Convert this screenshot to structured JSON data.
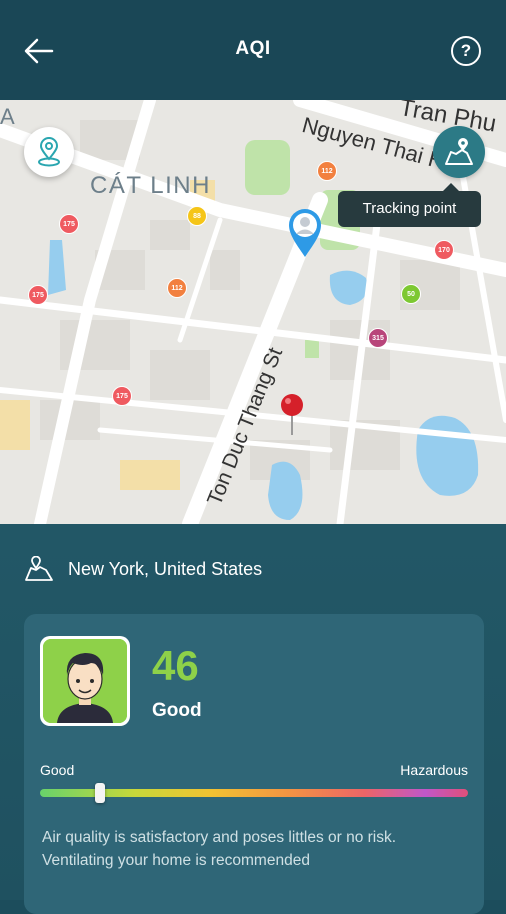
{
  "header": {
    "title": "AQI",
    "back_icon": "arrow-left-icon",
    "help_label": "?"
  },
  "map": {
    "labels": {
      "district": "CÁT LINH",
      "street_main": "Ton Duc Thang St",
      "street_top": "Nguyen Thai Hoc",
      "street_top2": "Tran Phu",
      "edge_letter": "A"
    },
    "tooltip": "Tracking point",
    "aqi_markers": [
      {
        "value": "175",
        "color": "#ef5a60"
      },
      {
        "value": "175",
        "color": "#ef5a60"
      },
      {
        "value": "175",
        "color": "#ef5a60"
      },
      {
        "value": "88",
        "color": "#f5c518"
      },
      {
        "value": "112",
        "color": "#f2803f"
      },
      {
        "value": "112",
        "color": "#f2803f"
      },
      {
        "value": "170",
        "color": "#ef5a60"
      },
      {
        "value": "50",
        "color": "#7dc832"
      },
      {
        "value": "315",
        "color": "#b8457a"
      }
    ]
  },
  "location": {
    "icon": "map-location-icon",
    "text": "New York, United States"
  },
  "aqi_card": {
    "value": "46",
    "status": "Good",
    "value_color": "#8ed149",
    "scale_low": "Good",
    "scale_high": "Hazardous",
    "scale_position": 0.14,
    "description": "Air quality is satisfactory and poses littles or no risk. Ventilating your home is recommended"
  }
}
